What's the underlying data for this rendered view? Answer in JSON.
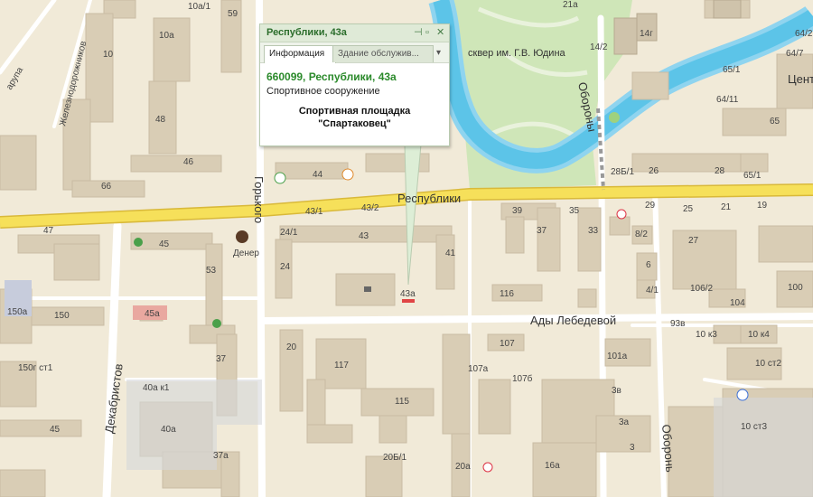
{
  "popup": {
    "title": "Республики, 43а",
    "pin_icon": "pin-icon",
    "close_icon": "close-icon",
    "tabs": [
      {
        "label": "Информация",
        "active": true
      },
      {
        "label": "Здание обслужив...",
        "active": false
      }
    ],
    "dropdown_icon": "chevron-down-icon",
    "address": "660099, Республики, 43а",
    "category": "Спортивное сооружение",
    "name_line1": "Спортивная площадка",
    "name_line2": "\"Спартаковец\""
  },
  "streets": {
    "respubliki": "Республики",
    "gorkogo": "Горького",
    "ady_lebedevoy": "Ады Лебедевой",
    "oborony": "Обороны",
    "oborony2": "Оборонь",
    "dekabristov": "Декабристов",
    "zheleznodorozhnikov": "Железнодорожников",
    "partial_left": "арупа"
  },
  "places": {
    "park": "сквер им. Г.В. Юдина",
    "center": "Цент",
    "dener": "Денер"
  },
  "building_numbers": {
    "b59": "59",
    "b10a1": "10а/1",
    "b10a": "10а",
    "b10": "10",
    "b48": "48",
    "b46": "46",
    "b66": "66",
    "b44": "44",
    "b43_1": "43/1",
    "b43_2": "43/2",
    "b43": "43",
    "b24_1": "24/1",
    "b24": "24",
    "b41": "41",
    "b43a": "43а",
    "b47": "47",
    "b45": "45",
    "b53": "53",
    "b45a": "45а",
    "b150a": "150а",
    "b150": "150",
    "b150g": "150г ст1",
    "b37": "37",
    "b20": "20",
    "b117": "117",
    "b115": "115",
    "b107": "107",
    "b107a": "107а",
    "b107b": "107б",
    "b116": "116",
    "b39": "39",
    "b35": "35",
    "b37r": "37",
    "b33": "33",
    "b29": "29",
    "b25": "25",
    "b21": "21",
    "b19": "19",
    "b28b1": "28Б/1",
    "b26": "26",
    "b28": "28",
    "b65_1": "65/1",
    "b65": "65",
    "b8_2": "8/2",
    "b27": "27",
    "b6": "6",
    "b4_1": "4/1",
    "b106_2": "106/2",
    "b104": "104",
    "b100": "100",
    "b93v": "93в",
    "b10k3": "10 к3",
    "b10k4": "10 к4",
    "b10st2": "10 ст2",
    "b101a": "101а",
    "b3v": "3в",
    "b3a": "3а",
    "b3": "3",
    "b16a": "16а",
    "b10st3": "10 ст3",
    "b40ak1": "40а к1",
    "b40a": "40а",
    "b37a": "37а",
    "b20b1": "20Б/1",
    "b20a": "20а",
    "b45l": "45",
    "b21a": "21а",
    "b14_2": "14/2",
    "b14g": "14г",
    "b64_7": "64/7",
    "b64_11": "64/11",
    "b65_1r": "65/1",
    "b64_2": "64/2"
  },
  "colors": {
    "ground": "#f1ead8",
    "building": "#d9cdb5",
    "building_tall": "#cfc3ab",
    "road": "#ffffff",
    "main_road": "#f6e05a",
    "main_road_edge": "#d9b93a",
    "river": "#5cc4e8",
    "river_edge": "#8fd4ef",
    "park": "#cfe6b8",
    "popup_accent": "#2b8a2b",
    "marker": "#e04545"
  }
}
